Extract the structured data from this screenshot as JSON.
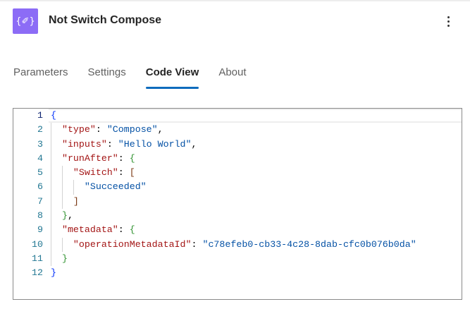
{
  "header": {
    "title": "Not Switch Compose",
    "icon": "braces-pencil-icon",
    "icon_glyph": "{✐}"
  },
  "tabs": [
    {
      "label": "Parameters"
    },
    {
      "label": "Settings"
    },
    {
      "label": "Code View",
      "active": true
    },
    {
      "label": "About"
    }
  ],
  "code": {
    "lines": [
      [
        {
          "t": "{",
          "c": "b1"
        }
      ],
      [
        {
          "t": "  "
        },
        {
          "t": "\"type\"",
          "c": "k"
        },
        {
          "t": ": ",
          "c": "p"
        },
        {
          "t": "\"Compose\"",
          "c": "s"
        },
        {
          "t": ",",
          "c": "p"
        }
      ],
      [
        {
          "t": "  "
        },
        {
          "t": "\"inputs\"",
          "c": "k"
        },
        {
          "t": ": ",
          "c": "p"
        },
        {
          "t": "\"Hello World\"",
          "c": "s"
        },
        {
          "t": ",",
          "c": "p"
        }
      ],
      [
        {
          "t": "  "
        },
        {
          "t": "\"runAfter\"",
          "c": "k"
        },
        {
          "t": ": ",
          "c": "p"
        },
        {
          "t": "{",
          "c": "b2"
        }
      ],
      [
        {
          "t": "    "
        },
        {
          "t": "\"Switch\"",
          "c": "k"
        },
        {
          "t": ": ",
          "c": "p"
        },
        {
          "t": "[",
          "c": "b3"
        }
      ],
      [
        {
          "t": "      "
        },
        {
          "t": "\"Succeeded\"",
          "c": "s"
        }
      ],
      [
        {
          "t": "    "
        },
        {
          "t": "]",
          "c": "b3"
        }
      ],
      [
        {
          "t": "  "
        },
        {
          "t": "}",
          "c": "b2"
        },
        {
          "t": ",",
          "c": "p"
        }
      ],
      [
        {
          "t": "  "
        },
        {
          "t": "\"metadata\"",
          "c": "k"
        },
        {
          "t": ": ",
          "c": "p"
        },
        {
          "t": "{",
          "c": "b2"
        }
      ],
      [
        {
          "t": "    "
        },
        {
          "t": "\"operationMetadataId\"",
          "c": "k"
        },
        {
          "t": ": ",
          "c": "p"
        },
        {
          "t": "\"c78efeb0-cb33-4c28-8dab-cfc0b076b0da\"",
          "c": "s"
        }
      ],
      [
        {
          "t": "  "
        },
        {
          "t": "}",
          "c": "b2"
        }
      ],
      [
        {
          "t": "}",
          "c": "b1"
        }
      ]
    ]
  }
}
